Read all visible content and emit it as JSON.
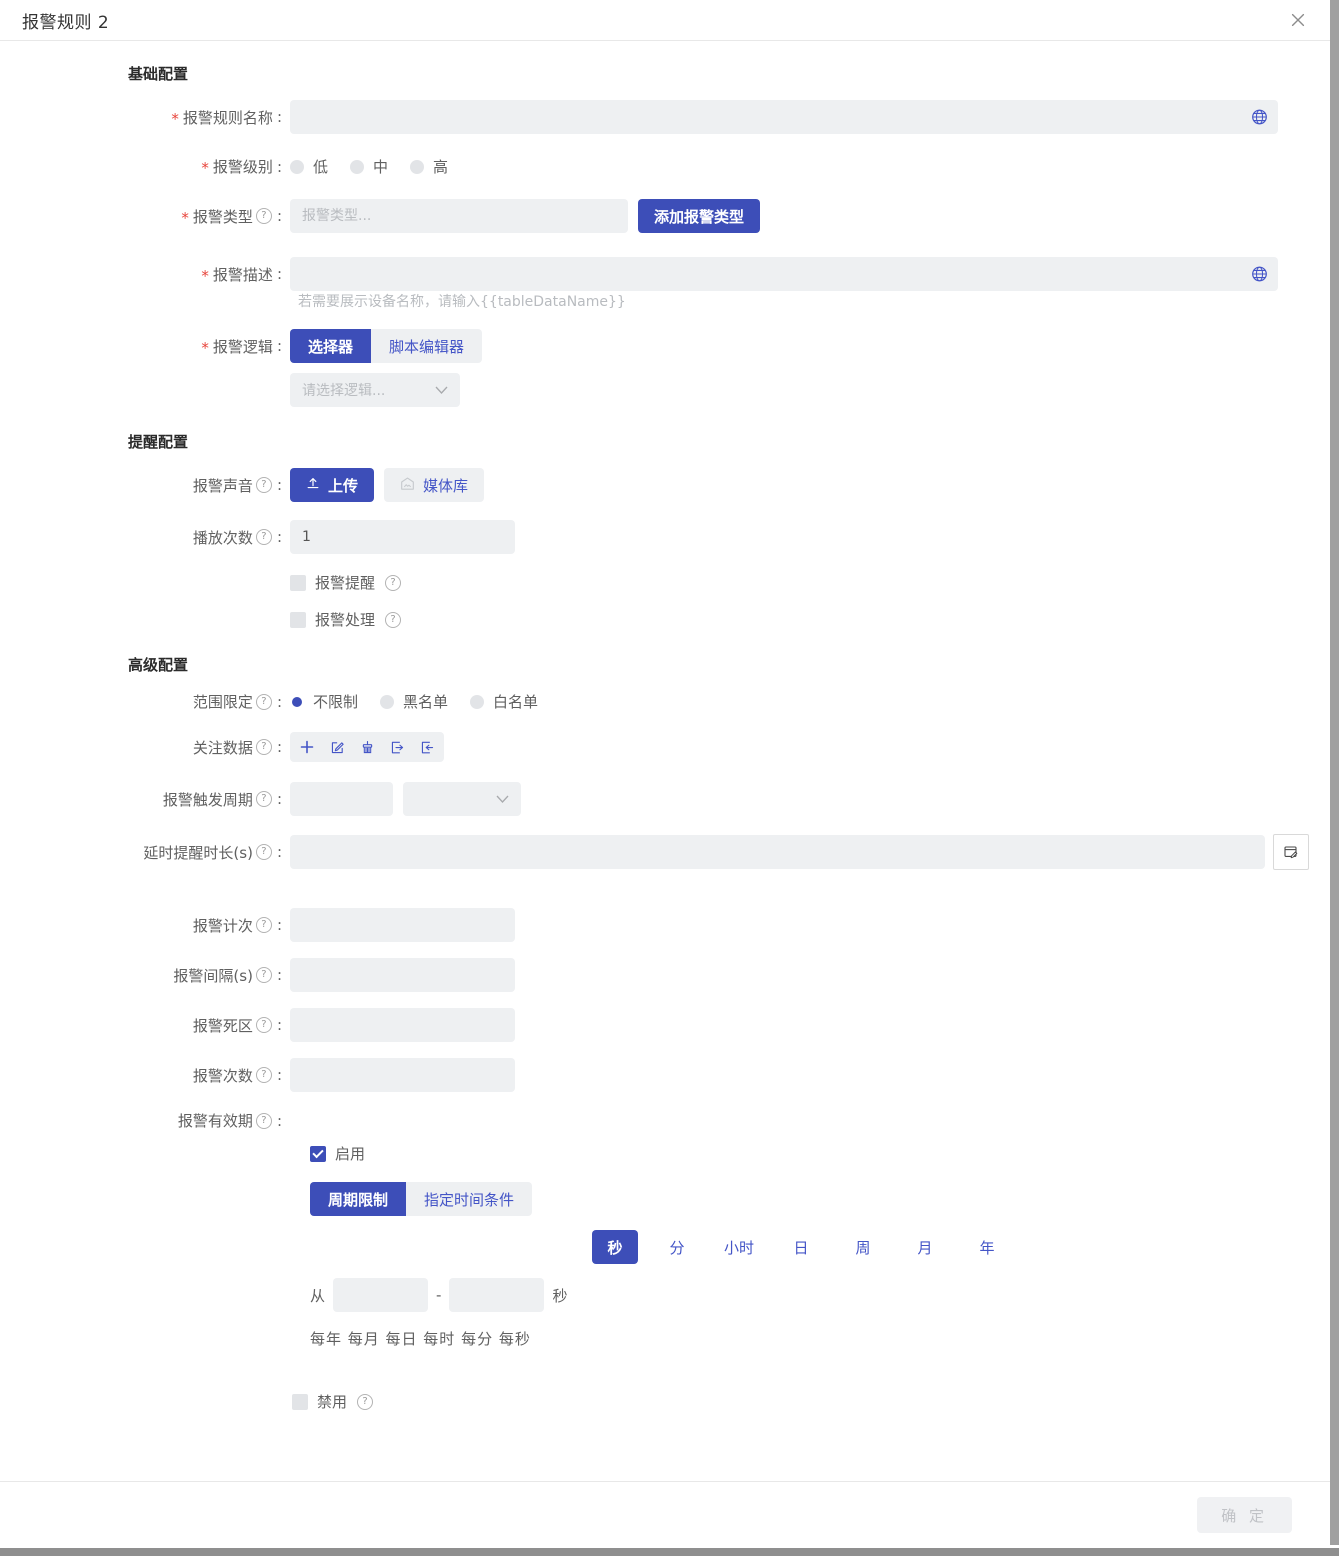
{
  "dialog": {
    "title": "报警规则 2",
    "close_icon": "close-icon",
    "confirm_label": "确 定"
  },
  "sections": {
    "basic": {
      "title": "基础配置",
      "rule_name": {
        "label": "报警规则名称",
        "value": "",
        "placeholder": "",
        "required": true,
        "globe_icon": "globe-icon"
      },
      "level": {
        "label": "报警级别",
        "required": true,
        "options": [
          {
            "label": "低",
            "selected": false
          },
          {
            "label": "中",
            "selected": false
          },
          {
            "label": "高",
            "selected": false
          }
        ]
      },
      "type": {
        "label": "报警类型",
        "required": true,
        "has_help": true,
        "value": "",
        "placeholder": "报警类型...",
        "add_button": "添加报警类型"
      },
      "description": {
        "label": "报警描述",
        "required": true,
        "value": "",
        "placeholder": "",
        "globe_icon": "globe-icon",
        "hint": "若需要展示设备名称，请输入{{tableDataName}}"
      },
      "logic": {
        "label": "报警逻辑",
        "required": true,
        "tabs": [
          {
            "label": "选择器",
            "active": true
          },
          {
            "label": "脚本编辑器",
            "active": false
          }
        ],
        "select_value": "请选择逻辑..."
      }
    },
    "reminder": {
      "title": "提醒配置",
      "sound": {
        "label": "报警声音",
        "has_help": true,
        "upload_label": "上传",
        "upload_icon": "upload-icon",
        "media_label": "媒体库",
        "media_icon": "media-library-icon"
      },
      "play_count": {
        "label": "播放次数",
        "has_help": true,
        "value": "1"
      },
      "alarm_reminder": {
        "label": "报警提醒",
        "checked": false,
        "has_help": true
      },
      "alarm_handling": {
        "label": "报警处理",
        "checked": false,
        "has_help": true
      }
    },
    "advanced": {
      "title": "高级配置",
      "scope": {
        "label": "范围限定",
        "has_help": true,
        "options": [
          {
            "label": "不限制",
            "selected": true
          },
          {
            "label": "黑名单",
            "selected": false
          },
          {
            "label": "白名单",
            "selected": false
          }
        ]
      },
      "watch_data": {
        "label": "关注数据",
        "has_help": true,
        "icons": [
          "plus-icon",
          "edit-icon",
          "broom-icon",
          "import-icon",
          "export-icon"
        ]
      },
      "trigger_period": {
        "label": "报警触发周期",
        "has_help": true,
        "value": "",
        "select_value": "",
        "caret_icon": "chevron-down-icon"
      },
      "delay_duration": {
        "label": "延时提醒时长(s)",
        "has_help": true,
        "value": "",
        "editor_icon": "script-editor-icon"
      },
      "alarm_count_times": {
        "label": "报警计次",
        "has_help": true,
        "value": ""
      },
      "alarm_interval": {
        "label": "报警间隔(s)",
        "has_help": true,
        "value": ""
      },
      "alarm_deadzone": {
        "label": "报警死区",
        "has_help": true,
        "value": ""
      },
      "alarm_times": {
        "label": "报警次数",
        "has_help": true,
        "value": ""
      },
      "validity": {
        "label": "报警有效期",
        "has_help": true,
        "enable": {
          "label": "启用",
          "checked": true
        },
        "mode_tabs": [
          {
            "label": "周期限制",
            "active": true
          },
          {
            "label": "指定时间条件",
            "active": false
          }
        ],
        "unit_tabs": [
          {
            "label": "秒",
            "active": true
          },
          {
            "label": "分",
            "active": false
          },
          {
            "label": "小时",
            "active": false
          },
          {
            "label": "日",
            "active": false
          },
          {
            "label": "周",
            "active": false
          },
          {
            "label": "月",
            "active": false
          },
          {
            "label": "年",
            "active": false
          }
        ],
        "range": {
          "lead": "从",
          "from_value": "",
          "dash": "-",
          "to_value": "",
          "trail": "秒"
        },
        "summary": "每年 每月 每日 每时 每分 每秒",
        "disable": {
          "label": "禁用",
          "checked": false,
          "has_help": true
        }
      }
    }
  },
  "colors": {
    "primary": "#3d4eb8",
    "link": "#4455c7",
    "field_bg": "#eef0f2",
    "required_star": "#e8453c"
  }
}
